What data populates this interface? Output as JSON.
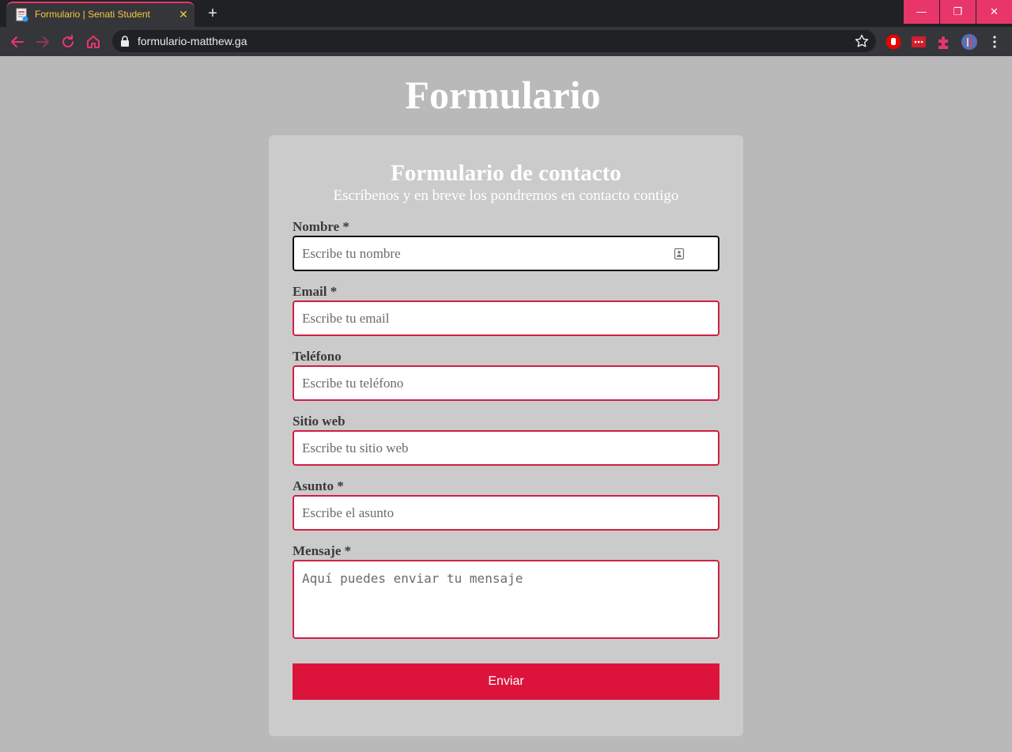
{
  "browser": {
    "tab_title": "Formulario | Senati Student",
    "tab_close": "✕",
    "new_tab": "+",
    "url": "formulario-matthew.ga",
    "window_controls": {
      "minimize": "—",
      "maximize": "❐",
      "close": "✕"
    },
    "accent_color": "#e8366b"
  },
  "page": {
    "title": "Formulario"
  },
  "form": {
    "title": "Formulario de contacto",
    "subtitle": "Escríbenos y en breve los pondremos en contacto contigo",
    "fields": [
      {
        "label": "Nombre *",
        "placeholder": "Escribe tu nombre"
      },
      {
        "label": "Email *",
        "placeholder": "Escribe tu email"
      },
      {
        "label": "Teléfono",
        "placeholder": "Escribe tu teléfono"
      },
      {
        "label": "Sitio web",
        "placeholder": "Escribe tu sitio web"
      },
      {
        "label": "Asunto *",
        "placeholder": "Escribe el asunto"
      }
    ],
    "message": {
      "label": "Mensaje *",
      "placeholder": "Aquí puedes enviar tu mensaje"
    },
    "submit_label": "Enviar",
    "accent_color": "#dc143c"
  }
}
